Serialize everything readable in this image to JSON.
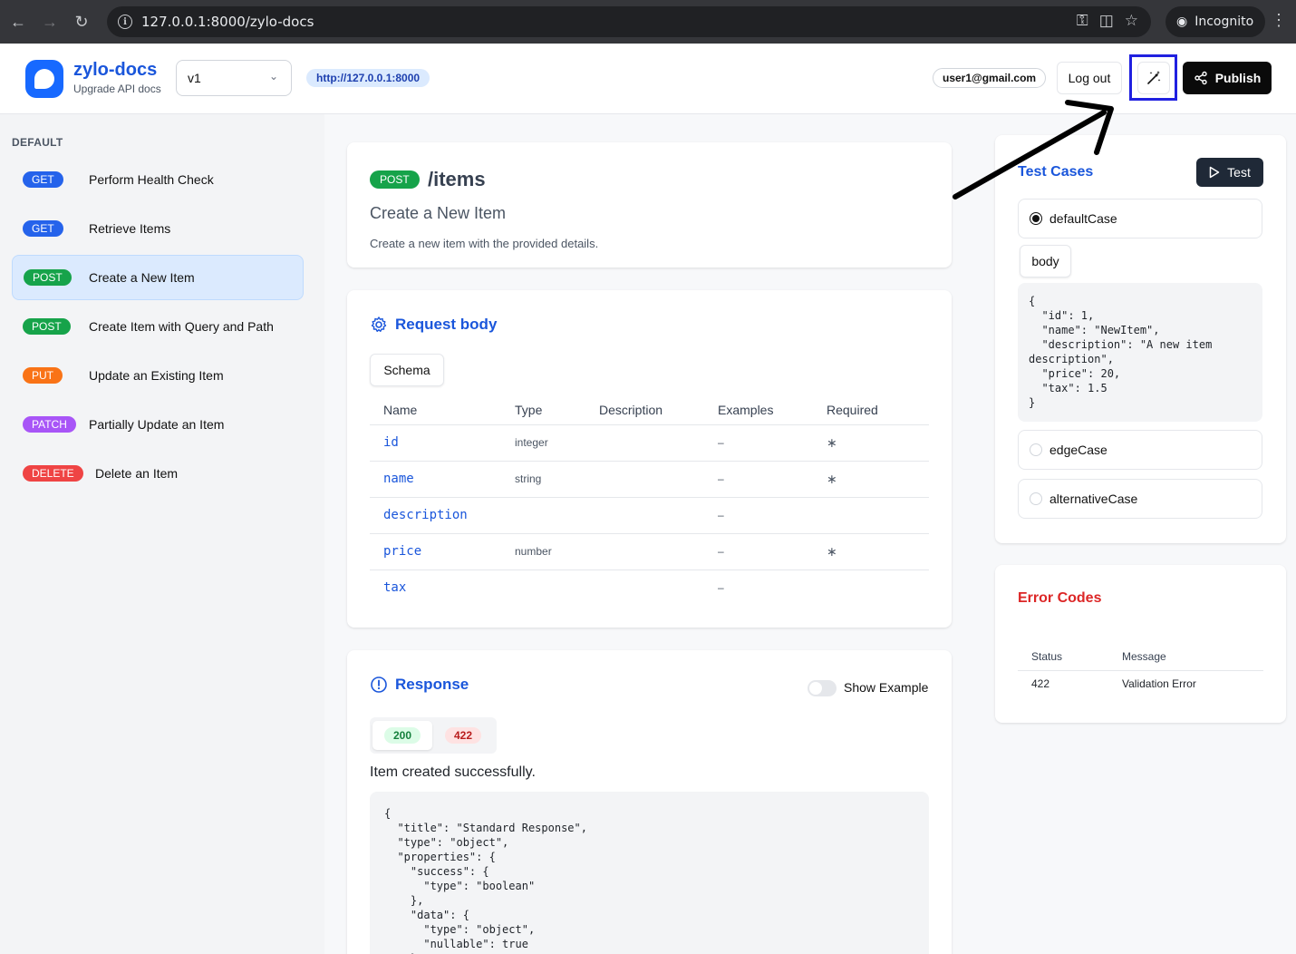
{
  "browser": {
    "url": "127.0.0.1:8000/zylo-docs",
    "profile_label": "Incognito"
  },
  "header": {
    "brand_name": "zylo-docs",
    "brand_subtitle": "Upgrade API docs",
    "version": "v1",
    "base_url": "http://127.0.0.1:8000",
    "user_email": "user1@gmail.com",
    "logout_label": "Log out",
    "publish_label": "Publish"
  },
  "sidebar": {
    "heading": "DEFAULT",
    "items": [
      {
        "method": "GET",
        "label": "Perform Health Check"
      },
      {
        "method": "GET",
        "label": "Retrieve Items"
      },
      {
        "method": "POST",
        "label": "Create a New Item",
        "active": true
      },
      {
        "method": "POST",
        "label": "Create Item with Query and Path"
      },
      {
        "method": "PUT",
        "label": "Update an Existing Item"
      },
      {
        "method": "PATCH",
        "label": "Partially Update an Item"
      },
      {
        "method": "DELETE",
        "label": "Delete an Item"
      }
    ]
  },
  "endpoint": {
    "method": "POST",
    "path": "/items",
    "title": "Create a New Item",
    "description": "Create a new item with the provided details."
  },
  "request_body": {
    "title": "Request body",
    "tab": "Schema",
    "columns": [
      "Name",
      "Type",
      "Description",
      "Examples",
      "Required"
    ],
    "rows": [
      {
        "name": "id",
        "type": "integer",
        "description": "",
        "examples": "–",
        "required": "∗"
      },
      {
        "name": "name",
        "type": "string",
        "description": "",
        "examples": "–",
        "required": "∗"
      },
      {
        "name": "description",
        "type": "",
        "description": "",
        "examples": "–",
        "required": ""
      },
      {
        "name": "price",
        "type": "number",
        "description": "",
        "examples": "–",
        "required": "∗"
      },
      {
        "name": "tax",
        "type": "",
        "description": "",
        "examples": "–",
        "required": ""
      }
    ]
  },
  "response": {
    "title": "Response",
    "toggle_label": "Show Example",
    "status_tabs": [
      "200",
      "422"
    ],
    "description": "Item created successfully.",
    "code": "{\n  \"title\": \"Standard Response\",\n  \"type\": \"object\",\n  \"properties\": {\n    \"success\": {\n      \"type\": \"boolean\"\n    },\n    \"data\": {\n      \"type\": \"object\",\n      \"nullable\": true\n    },"
  },
  "test_cases": {
    "title": "Test Cases",
    "test_label": "Test",
    "cases": [
      "defaultCase",
      "edgeCase",
      "alternativeCase"
    ],
    "selected": "defaultCase",
    "tab": "body",
    "code": "{\n  \"id\": 1,\n  \"name\": \"NewItem\",\n  \"description\": \"A new item\ndescription\",\n  \"price\": 20,\n  \"tax\": 1.5\n}"
  },
  "error_codes": {
    "title": "Error Codes",
    "columns": [
      "Status",
      "Message"
    ],
    "rows": [
      {
        "status": "422",
        "message": "Validation Error"
      }
    ]
  },
  "colors": {
    "accent": "#1a56db",
    "get": "#2563eb",
    "post": "#16a34a",
    "put": "#f97316",
    "patch": "#a855f7",
    "delete": "#ef4444",
    "highlight_box": "#2020e0"
  }
}
